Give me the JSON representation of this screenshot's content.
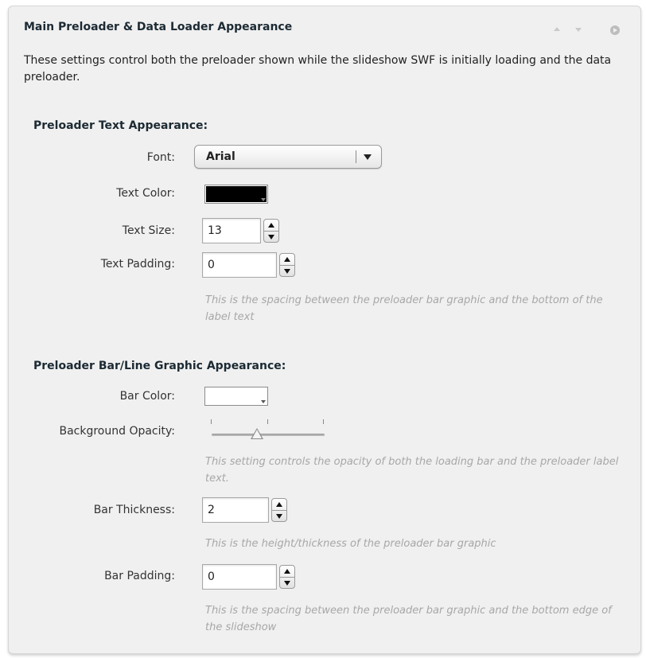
{
  "panel": {
    "title": "Main Preloader & Data Loader Appearance",
    "description": "These settings control both the preloader shown while the slideshow SWF is initially loading and the data preloader.",
    "icons": [
      "move-up-icon",
      "move-down-icon",
      "collapse-icon"
    ]
  },
  "text_section": {
    "heading": "Preloader Text Appearance:",
    "font": {
      "label": "Font:",
      "value": "Arial"
    },
    "text_color": {
      "label": "Text Color:",
      "color": "#000000"
    },
    "text_size": {
      "label": "Text Size:",
      "value": "13"
    },
    "text_padding": {
      "label": "Text Padding:",
      "value": "0",
      "hint": "This is the spacing between the preloader bar graphic and the bottom of the label text"
    }
  },
  "bar_section": {
    "heading": "Preloader Bar/Line Graphic Appearance:",
    "bar_color": {
      "label": "Bar Color:",
      "color": "#ffffff"
    },
    "background_opacity": {
      "label": "Background Opacity:",
      "level": 0.4,
      "hint": "This setting controls the opacity of both the loading bar and the preloader label text."
    },
    "bar_thickness": {
      "label": "Bar Thickness:",
      "value": "2",
      "hint": "This is the height/thickness of the preloader bar graphic"
    },
    "bar_padding": {
      "label": "Bar Padding:",
      "value": "0",
      "hint": "This is the spacing between the preloader bar graphic and the bottom edge of the slideshow"
    }
  }
}
